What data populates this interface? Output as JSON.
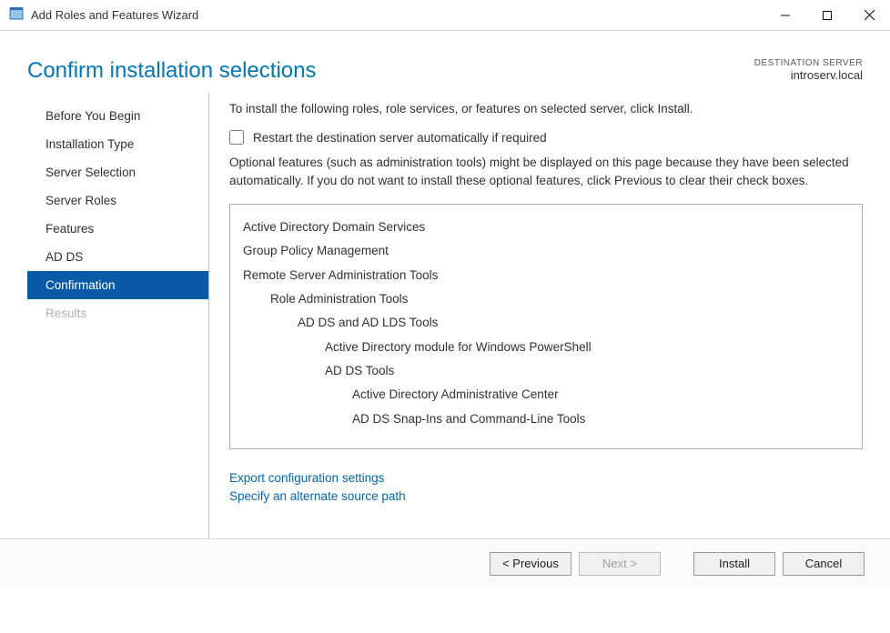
{
  "window": {
    "title": "Add Roles and Features Wizard"
  },
  "header": {
    "page_title": "Confirm installation selections",
    "dest_label": "DESTINATION SERVER",
    "dest_server": "introserv.local"
  },
  "sidebar": {
    "items": [
      {
        "label": "Before You Begin",
        "state": "normal"
      },
      {
        "label": "Installation Type",
        "state": "normal"
      },
      {
        "label": "Server Selection",
        "state": "normal"
      },
      {
        "label": "Server Roles",
        "state": "normal"
      },
      {
        "label": "Features",
        "state": "normal"
      },
      {
        "label": "AD DS",
        "state": "normal"
      },
      {
        "label": "Confirmation",
        "state": "selected"
      },
      {
        "label": "Results",
        "state": "disabled"
      }
    ]
  },
  "content": {
    "instruction": "To install the following roles, role services, or features on selected server, click Install.",
    "restart_checkbox": {
      "label": "Restart the destination server automatically if required",
      "checked": false
    },
    "optional_text": "Optional features (such as administration tools) might be displayed on this page because they have been selected automatically. If you do not want to install these optional features, click Previous to clear their check boxes.",
    "tree": [
      {
        "label": "Active Directory Domain Services",
        "indent": 0
      },
      {
        "label": "Group Policy Management",
        "indent": 0
      },
      {
        "label": "Remote Server Administration Tools",
        "indent": 0
      },
      {
        "label": "Role Administration Tools",
        "indent": 1
      },
      {
        "label": "AD DS and AD LDS Tools",
        "indent": 2
      },
      {
        "label": "Active Directory module for Windows PowerShell",
        "indent": 3
      },
      {
        "label": "AD DS Tools",
        "indent": 3
      },
      {
        "label": "Active Directory Administrative Center",
        "indent": 4
      },
      {
        "label": "AD DS Snap-Ins and Command-Line Tools",
        "indent": 4
      }
    ],
    "links": {
      "export": "Export configuration settings",
      "alt_source": "Specify an alternate source path"
    }
  },
  "footer": {
    "previous": "< Previous",
    "next": "Next >",
    "install": "Install",
    "cancel": "Cancel"
  }
}
